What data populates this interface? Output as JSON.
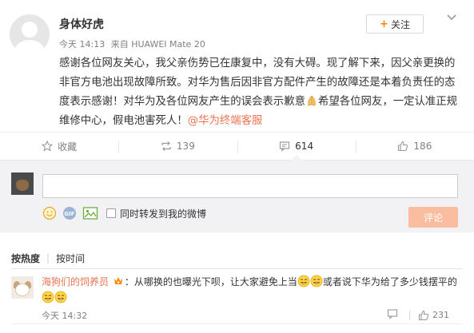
{
  "post": {
    "username": "身体好虎",
    "time": "今天 14:13",
    "source": "来自 HUAWEI Mate 20",
    "follow_label": "关注",
    "text_1": "感谢各位网友关心，我父亲伤势已在康复中，没有大碍。现了解下来，因父亲更换的非官方电池出现故障所致。对华为售后因非官方配件产生的故障还是本着负责任的态度表示感谢！对华为及各位网友产生的误会表示歉意",
    "text_2": "希望各位网友，一定认准正规维修中心，假电池害死人！",
    "mention": "@华为终端客服"
  },
  "actions": {
    "favorite_label": "收藏",
    "repost_count": "139",
    "comment_count": "614",
    "like_count": "186"
  },
  "comment_box": {
    "input_value": "",
    "repost_label": "同时转发到我的微博",
    "submit_label": "评论"
  },
  "sort": {
    "hot_label": "按热度",
    "time_label": "按时间"
  },
  "comment": {
    "user": "海狗们的饲养员",
    "text_1": "：从哪换的也曝光下呗，让大家避免上当",
    "text_2": "或者说下华为给了多少钱摆平的",
    "time": "今天 14:32",
    "like_count": "231"
  },
  "icons": {
    "more": "chevron-down-icon",
    "favorite": "star-icon",
    "repost": "repost-icon",
    "comment": "comment-icon",
    "like": "thumbs-up-icon",
    "emoji_tool": "smiley-icon",
    "gif_tool": "gif-icon",
    "image_tool": "image-icon"
  },
  "colors": {
    "accent": "#eb7350",
    "follow_plus": "#ff8200",
    "submit_disabled": "#fbbd9f",
    "meta_gray": "#808080"
  }
}
